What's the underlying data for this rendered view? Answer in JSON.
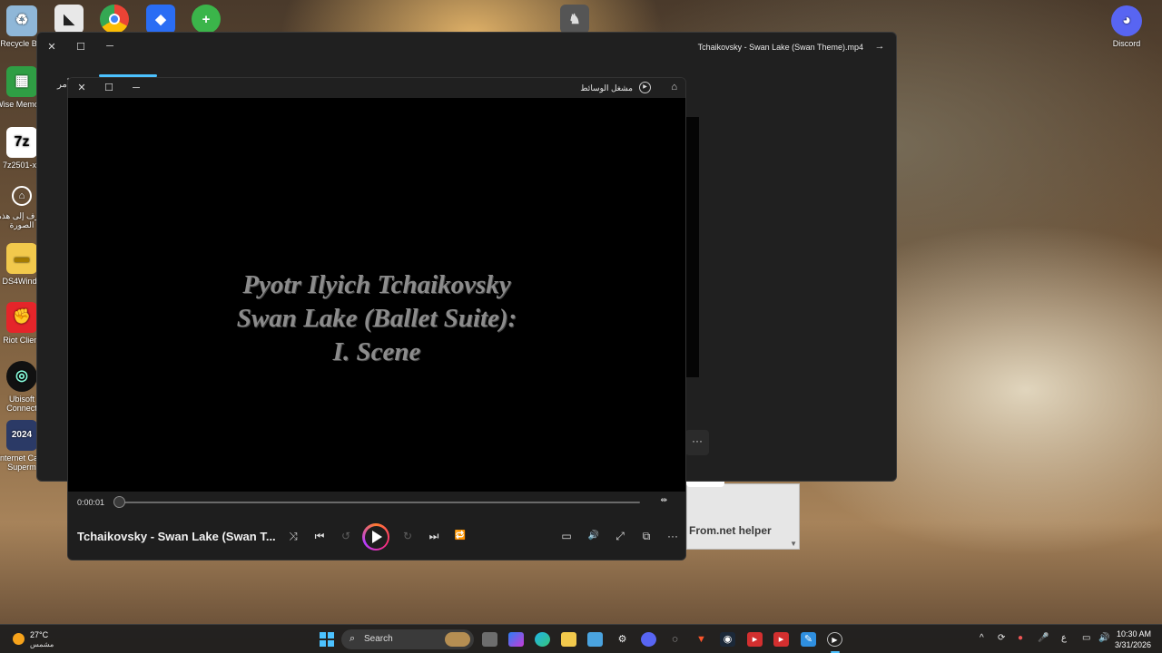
{
  "desktop": {
    "left_icons": [
      {
        "label": "Recycle Bin",
        "icon": "recycle-bin-icon"
      },
      {
        "label": "Wise Memor...",
        "icon": "wise-memory-icon"
      },
      {
        "label": "7z2501-x6",
        "icon": "7zip-icon"
      },
      {
        "label": "شرف إلى هذه الصورة",
        "icon": "image-link-icon"
      },
      {
        "label": "DS4Windo",
        "icon": "folder-icon"
      },
      {
        "label": "Riot Client",
        "icon": "riot-client-icon"
      },
      {
        "label": "Ubisoft Connect",
        "icon": "ubisoft-icon"
      },
      {
        "label": "Internet Ca & Superm",
        "icon": "game-icon"
      }
    ],
    "right_icons": [
      {
        "label": "Discord",
        "icon": "discord-icon"
      }
    ]
  },
  "back_window": {
    "title": "Tchaikovsky - Swan Lake (Swan Theme).mp4",
    "side_text": "أمر",
    "more_label": "···"
  },
  "helper_panel": {
    "text": "From.net helper",
    "arrow": "▼"
  },
  "player": {
    "app_name": "مشغل الوسائط",
    "video_text": [
      "Pyotr Ilyich Tchaikovsky",
      "Swan Lake (Ballet Suite):",
      "I. Scene"
    ],
    "time": "0:00:01",
    "progress": 0.01,
    "now_playing": "Tchaikovsky - Swan Lake (Swan T...",
    "controls": {
      "shuffle": "⤨",
      "previous": "⏮",
      "back10": "↺",
      "forward30": "↻",
      "next": "⏭",
      "repeat": "🔁",
      "captions": "▭",
      "volume": "🔊",
      "fullscreen": "⤢",
      "miniplayer": "⧉",
      "more": "···",
      "ab": "⇹"
    }
  },
  "taskbar": {
    "weather_temp": "27°C",
    "weather_desc": "مشمس",
    "search_placeholder": "Search",
    "time": "10:30 AM",
    "date": "3/31/2026",
    "tray_lang": "ع"
  }
}
